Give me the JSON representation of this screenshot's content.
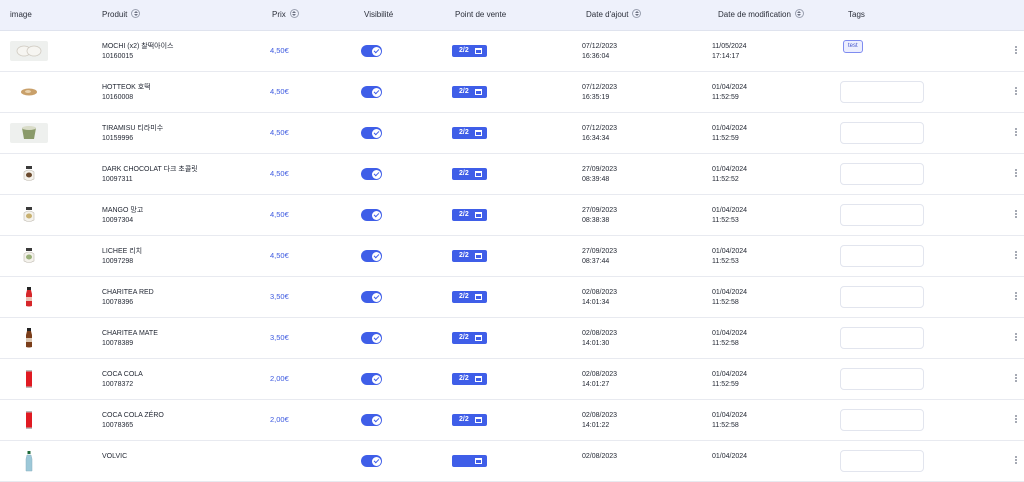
{
  "headers": {
    "image": "image",
    "produit": "Produit",
    "prix": "Prix",
    "visibilite": "Visibilité",
    "point_de_vente": "Point de vente",
    "date_ajout": "Date d'ajout",
    "date_modification": "Date de modification",
    "tags": "Tags"
  },
  "icons": {
    "sort": "sort-icon",
    "toggle": "toggle-switch-icon",
    "calendar": "calendar-icon",
    "menu": "more-vertical-icon"
  },
  "colors": {
    "accent": "#3f5ee8",
    "price": "#3d5ae0",
    "header_bg": "#eef1fb"
  },
  "rows": [
    {
      "name": "MOCHI (x2) 찰떡아이스",
      "code": "10160015",
      "price": "4,50€",
      "visible": true,
      "pv": "2/2",
      "added_date": "07/12/2023",
      "added_time": "16:36:04",
      "mod_date": "11/05/2024",
      "mod_time": "17:14:17",
      "tag": "test",
      "thumb": "mochi",
      "thumb_color": "#e8e6e0"
    },
    {
      "name": "HOTTEOK 호떡",
      "code": "10160008",
      "price": "4,50€",
      "visible": true,
      "pv": "2/2",
      "added_date": "07/12/2023",
      "added_time": "16:35:19",
      "mod_date": "01/04/2024",
      "mod_time": "11:52:59",
      "tag": "",
      "thumb": "hotteok",
      "thumb_color": "#c9a06a"
    },
    {
      "name": "TIRAMISU 티라미수",
      "code": "10159996",
      "price": "4,50€",
      "visible": true,
      "pv": "2/2",
      "added_date": "07/12/2023",
      "added_time": "16:34:34",
      "mod_date": "01/04/2024",
      "mod_time": "11:52:59",
      "tag": "",
      "thumb": "tiramisu",
      "thumb_color": "#8a9a6a"
    },
    {
      "name": "DARK CHOCOLAT 다크 초콜릿",
      "code": "10097311",
      "price": "4,50€",
      "visible": true,
      "pv": "2/2",
      "added_date": "27/09/2023",
      "added_time": "08:39:48",
      "mod_date": "01/04/2024",
      "mod_time": "11:52:52",
      "tag": "",
      "thumb": "jar",
      "thumb_color": "#6b4a2e"
    },
    {
      "name": "MANGO 망고",
      "code": "10097304",
      "price": "4,50€",
      "visible": true,
      "pv": "2/2",
      "added_date": "27/09/2023",
      "added_time": "08:38:38",
      "mod_date": "01/04/2024",
      "mod_time": "11:52:53",
      "tag": "",
      "thumb": "jar",
      "thumb_color": "#c8b070"
    },
    {
      "name": "LICHEE 리치",
      "code": "10097298",
      "price": "4,50€",
      "visible": true,
      "pv": "2/2",
      "added_date": "27/09/2023",
      "added_time": "08:37:44",
      "mod_date": "01/04/2024",
      "mod_time": "11:52:53",
      "tag": "",
      "thumb": "jar",
      "thumb_color": "#9ab07a"
    },
    {
      "name": "CHARITEA RED",
      "code": "10078396",
      "price": "3,50€",
      "visible": true,
      "pv": "2/2",
      "added_date": "02/08/2023",
      "added_time": "14:01:34",
      "mod_date": "01/04/2024",
      "mod_time": "11:52:58",
      "tag": "",
      "thumb": "bottle",
      "thumb_color": "#d6262a"
    },
    {
      "name": "CHARITEA MATE",
      "code": "10078389",
      "price": "3,50€",
      "visible": true,
      "pv": "2/2",
      "added_date": "02/08/2023",
      "added_time": "14:01:30",
      "mod_date": "01/04/2024",
      "mod_time": "11:52:58",
      "tag": "",
      "thumb": "bottle",
      "thumb_color": "#7a3e1a"
    },
    {
      "name": "COCA COLA",
      "code": "10078372",
      "price": "2,00€",
      "visible": true,
      "pv": "2/2",
      "added_date": "02/08/2023",
      "added_time": "14:01:27",
      "mod_date": "01/04/2024",
      "mod_time": "11:52:59",
      "tag": "",
      "thumb": "can",
      "thumb_color": "#e01a22"
    },
    {
      "name": "COCA COLA ZÉRO",
      "code": "10078365",
      "price": "2,00€",
      "visible": true,
      "pv": "2/2",
      "added_date": "02/08/2023",
      "added_time": "14:01:22",
      "mod_date": "01/04/2024",
      "mod_time": "11:52:58",
      "tag": "",
      "thumb": "can",
      "thumb_color": "#e01a22"
    },
    {
      "name": "VOLVIC",
      "code": "",
      "price": "",
      "visible": true,
      "pv": "",
      "added_date": "02/08/2023",
      "added_time": "",
      "mod_date": "01/04/2024",
      "mod_time": "",
      "tag": "",
      "thumb": "water",
      "thumb_color": "#9cc8d8"
    }
  ]
}
